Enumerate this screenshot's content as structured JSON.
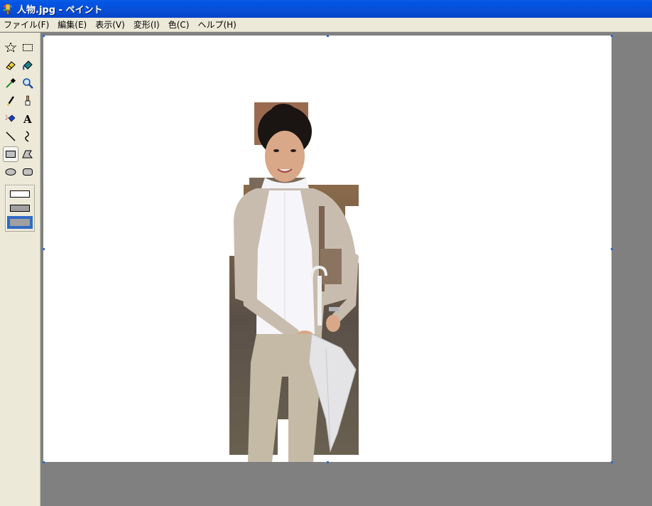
{
  "window": {
    "title": "人物.jpg - ペイント"
  },
  "menu": {
    "items": [
      {
        "name": "file",
        "label": "ファイル(F)"
      },
      {
        "name": "edit",
        "label": "編集(E)"
      },
      {
        "name": "view",
        "label": "表示(V)"
      },
      {
        "name": "image",
        "label": "変形(I)"
      },
      {
        "name": "colors",
        "label": "色(C)"
      },
      {
        "name": "help",
        "label": "ヘルプ(H)"
      }
    ]
  },
  "toolbox": {
    "tools": [
      {
        "name": "free-form-select-tool",
        "icon": "star-select-icon"
      },
      {
        "name": "rect-select-tool",
        "icon": "dashed-rect-icon"
      },
      {
        "name": "eraser-tool",
        "icon": "eraser-icon"
      },
      {
        "name": "fill-tool",
        "icon": "paint-bucket-icon"
      },
      {
        "name": "pick-color-tool",
        "icon": "eyedropper-icon"
      },
      {
        "name": "magnifier-tool",
        "icon": "magnifier-icon"
      },
      {
        "name": "pencil-tool",
        "icon": "pencil-icon"
      },
      {
        "name": "brush-tool",
        "icon": "brush-icon"
      },
      {
        "name": "airbrush-tool",
        "icon": "airbrush-icon"
      },
      {
        "name": "text-tool",
        "icon": "text-a-icon"
      },
      {
        "name": "line-tool",
        "icon": "line-icon"
      },
      {
        "name": "curve-tool",
        "icon": "curve-icon"
      },
      {
        "name": "rectangle-tool",
        "icon": "rectangle-icon"
      },
      {
        "name": "polygon-tool",
        "icon": "polygon-icon"
      },
      {
        "name": "ellipse-tool",
        "icon": "ellipse-icon"
      },
      {
        "name": "rounded-rect-tool",
        "icon": "rounded-rect-icon"
      }
    ],
    "selected_tool": "rectangle-tool",
    "fill_styles": [
      "outline",
      "outline-fill",
      "fill"
    ],
    "selected_fill_style": "fill"
  },
  "colors": {
    "title_bar": "#0054e3",
    "face": "#ece9d8",
    "workspace": "#808080",
    "canvas": "#ffffff",
    "selection": "#316ac5"
  }
}
